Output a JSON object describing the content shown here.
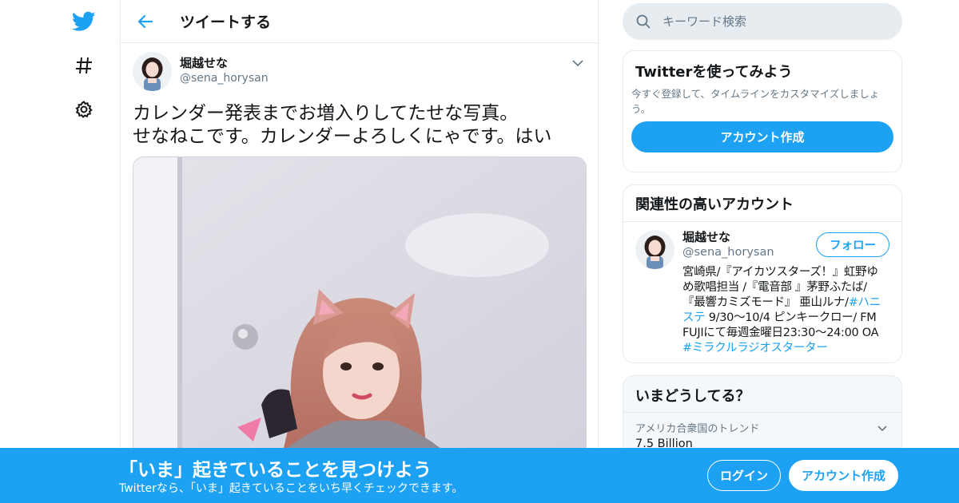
{
  "colors": {
    "accent": "#1da1f2",
    "text": "#14171a",
    "muted": "#657786",
    "border": "#e6ecf0"
  },
  "nav": {
    "items": [
      {
        "icon": "twitter-logo-icon"
      },
      {
        "icon": "hashtag-icon"
      },
      {
        "icon": "gear-icon"
      }
    ]
  },
  "header": {
    "title": "ツイートする"
  },
  "tweet": {
    "author_name": "堀越せな",
    "author_handle": "@sena_horysan",
    "text_lines": [
      "カレンダー発表までお増入りしてたせな写真。",
      "せなねこです。カレンダーよろしくにゃです。はい"
    ]
  },
  "search": {
    "placeholder": "キーワード検索"
  },
  "signup_card": {
    "title": "Twitterを使ってみよう",
    "description": "今すぐ登録して、タイムラインをカスタマイズしましょう。",
    "button": "アカウント作成"
  },
  "related": {
    "title": "関連性の高いアカウント",
    "account": {
      "name": "堀越せな",
      "handle": "@sena_horysan",
      "follow_label": "フォロー",
      "bio_line1": "宮崎県/『アイカツスターズ！』虹野ゆ",
      "bio_line2": "め歌唱担当 /『電音部 』茅野ふたば/",
      "bio_line3_text": "『最響カミズモード』 亜山ルナ/",
      "bio_line3_tag": "#ハニ",
      "bio_line4_tag": "ステ",
      "bio_line4_text": " 9/30〜10/4 ピンキークロー/ FM",
      "bio_line5": "FUJIにて毎週金曜日23:30〜24:00 OA",
      "bio_line6_tag": "#ミラクルラジオスターター"
    }
  },
  "trends": {
    "title": "いまどうしてる？",
    "items": [
      {
        "context": "アメリカ合衆国のトレンド",
        "name": "7.5 Billion"
      }
    ]
  },
  "banner": {
    "title": "「いま」起きていることを見つけよう",
    "subtitle": "Twitterなら、「いま」起きていることをいち早くチェックできます。",
    "login": "ログイン",
    "signup": "アカウント作成"
  }
}
